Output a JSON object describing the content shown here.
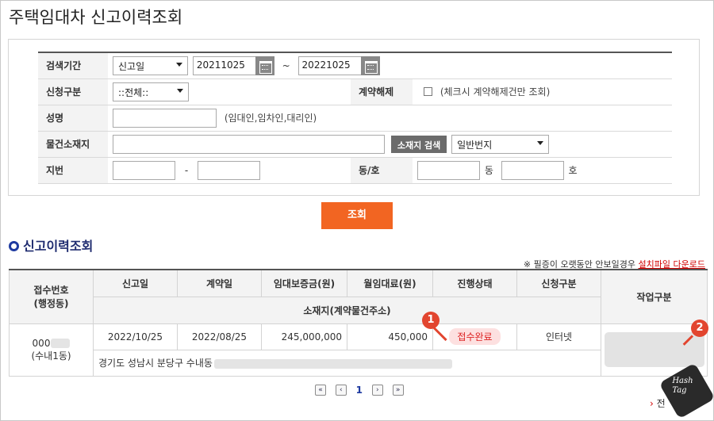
{
  "page_title": "주택임대차 신고이력조회",
  "search": {
    "period_label": "검색기간",
    "date_type": "신고일",
    "start_date": "20211025",
    "tilde": "~",
    "end_date": "20221025",
    "apply_type_label": "신청구분",
    "apply_type_value": "::전체::",
    "terminate_label": "계약해제",
    "terminate_hint": "(체크시 계약해제건만 조회)",
    "name_label": "성명",
    "name_hint": "(임대인,임차인,대리인)",
    "location_label": "물건소재지",
    "location_search_button": "소재지 검색",
    "address_type": "일반번지",
    "lot_label": "지번",
    "dash": "-",
    "dongho_label": "동/호",
    "dong_suffix": "동",
    "ho_suffix": "호",
    "submit": "조회"
  },
  "section_title": "신고이력조회",
  "notice": {
    "text": "※ 필증이 오랫동안 안보일경우",
    "link": "설치파일 다운로드"
  },
  "results": {
    "headers": {
      "receipt_no": "접수번호",
      "receipt_sub": "(행정동)",
      "report_date": "신고일",
      "contract_date": "계약일",
      "deposit": "임대보증금(원)",
      "rent": "월임대료(원)",
      "status": "진행상태",
      "apply_type": "신청구분",
      "work": "작업구분",
      "address": "소재지(계약물건주소)"
    },
    "rows": [
      {
        "receipt_no": "000",
        "dong": "(수내1동)",
        "report_date": "2022/10/25",
        "contract_date": "2022/08/25",
        "deposit": "245,000,000",
        "rent": "450,000",
        "status": "접수완료",
        "apply_type": "인터넷",
        "address": "경기도 성남시 분당구 수내동"
      }
    ]
  },
  "markers": [
    "1",
    "2"
  ],
  "pagination": {
    "first": "«",
    "prev": "‹",
    "current": "1",
    "next": "›",
    "last": "»"
  },
  "bottom_partial": "전",
  "watermark": "Hash Tag",
  "colors": {
    "accent": "#f26522",
    "section": "#1e2b6f",
    "marker": "#e2452f",
    "status_bg": "#fde0e0"
  }
}
